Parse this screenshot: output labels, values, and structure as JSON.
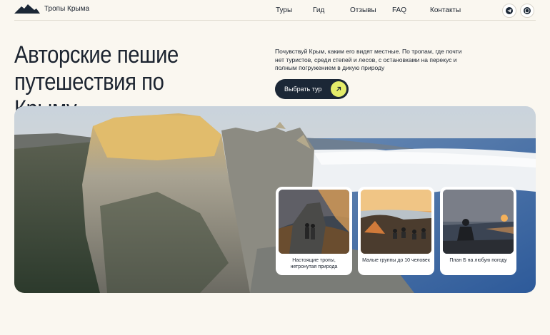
{
  "header": {
    "logo_text": "Тропы Крыма",
    "nav": [
      "Туры",
      "Гид",
      "Отзывы",
      "FAQ",
      "Контакты"
    ],
    "social": [
      "telegram-icon",
      "whatsapp-icon"
    ]
  },
  "hero": {
    "title_line1": "Авторские пешие",
    "title_line2": "путешествия по Крыму",
    "description": "Почувствуй Крым, каким его видят местные. По тропам, где почти нет туристов, среди степей и лесов, с остановками на перекус и полным погружением в дикую природу",
    "cta_label": "Выбрать тур",
    "cta_icon": "arrow-up-right-icon"
  },
  "cards": [
    {
      "label": "Настоящие тропы, нетронутая природа"
    },
    {
      "label": "Малые группы до 10 человек"
    },
    {
      "label": "План Б на любую погоду"
    }
  ],
  "colors": {
    "background": "#faf7f0",
    "dark": "#1b2736",
    "accent": "#e4ec6a"
  }
}
